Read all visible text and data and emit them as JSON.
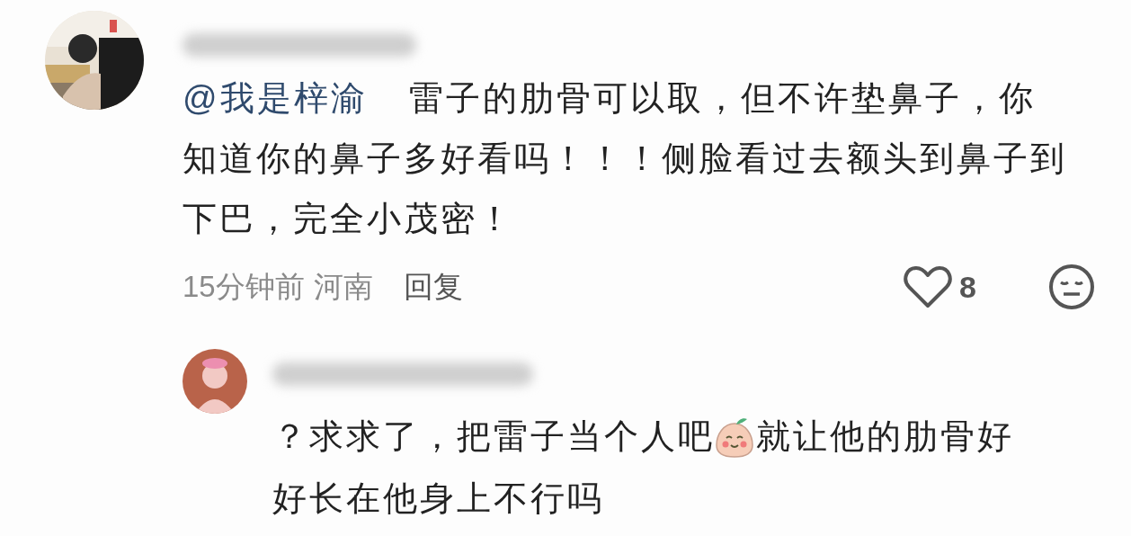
{
  "comment": {
    "mention": "@我是梓渝",
    "text": "雷子的肋骨可以取，但不许垫鼻子，你知道你的鼻子多好看吗！！！侧脸看过去额头到鼻子到下巴，完全小茂密！",
    "time": "15分钟前",
    "location": "河南",
    "reply_label": "回复",
    "likes": "8",
    "liked": false
  },
  "reply": {
    "lines": [
      [
        {
          "kind": "text",
          "text": "？求求了，把雷子当个人吧"
        },
        {
          "kind": "emoji"
        },
        {
          "kind": "text",
          "text": "就让他的肋骨好"
        }
      ],
      [
        {
          "kind": "text",
          "text": "好长在他身上不行吗"
        }
      ]
    ]
  }
}
